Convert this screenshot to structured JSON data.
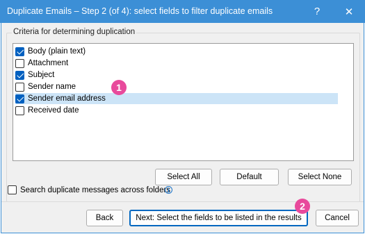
{
  "window": {
    "title": "Duplicate Emails – Step 2 (of 4): select fields to filter duplicate emails",
    "help_glyph": "?",
    "close_glyph": "✕"
  },
  "criteria": {
    "legend": "Criteria for determining duplication",
    "items": [
      {
        "label": "Body (plain text)",
        "checked": true,
        "selected": false
      },
      {
        "label": "Attachment",
        "checked": false,
        "selected": false
      },
      {
        "label": "Subject",
        "checked": true,
        "selected": false
      },
      {
        "label": "Sender name",
        "checked": false,
        "selected": false
      },
      {
        "label": "Sender email address",
        "checked": true,
        "selected": true
      },
      {
        "label": "Received date",
        "checked": false,
        "selected": false
      }
    ],
    "buttons": {
      "select_all": "Select All",
      "default": "Default",
      "select_none": "Select None"
    }
  },
  "search_across_folders": {
    "label": "Search duplicate messages across folders",
    "checked": false,
    "info_glyph": "i"
  },
  "footer": {
    "back": "Back",
    "next": "Next: Select the fields to be listed in the results",
    "cancel": "Cancel"
  },
  "callouts": [
    "1",
    "2"
  ],
  "colors": {
    "titlebar": "#3c8fd6",
    "checkbox_checked": "#0060c0",
    "selection": "#cce4f7",
    "callout": "#e84a9c"
  }
}
